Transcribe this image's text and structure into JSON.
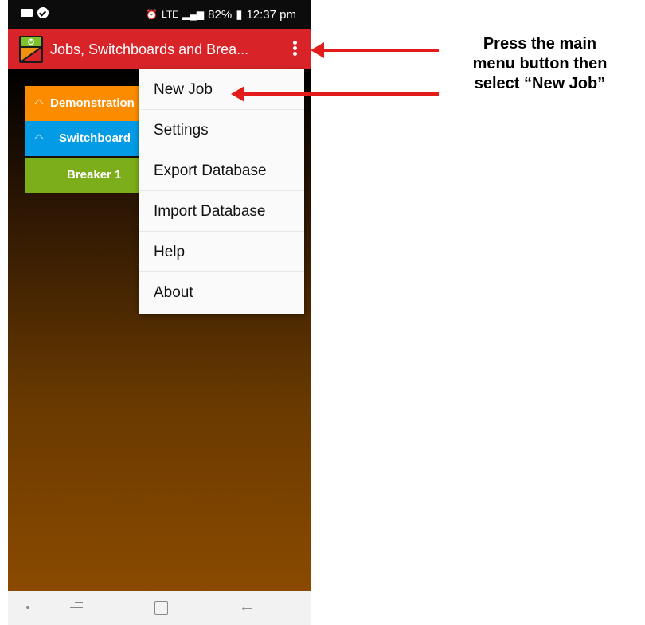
{
  "status_bar": {
    "battery": "82%",
    "time": "12:37 pm",
    "network": "LTE"
  },
  "app_bar": {
    "title": "Jobs, Switchboards and Brea..."
  },
  "tree": [
    {
      "label": "Demonstration",
      "color": "#fb8c00"
    },
    {
      "label": "Switchboard",
      "color": "#039be5"
    },
    {
      "label": "Breaker 1",
      "color": "#7cad1b"
    }
  ],
  "menu": {
    "items": [
      "New Job",
      "Settings",
      "Export Database",
      "Import Database",
      "Help",
      "About"
    ]
  },
  "annotation": {
    "line1": "Press the main",
    "line2": "menu button then",
    "line3": "select “New Job”"
  },
  "colors": {
    "accent": "#d82429",
    "arrow": "#e41b1b"
  }
}
